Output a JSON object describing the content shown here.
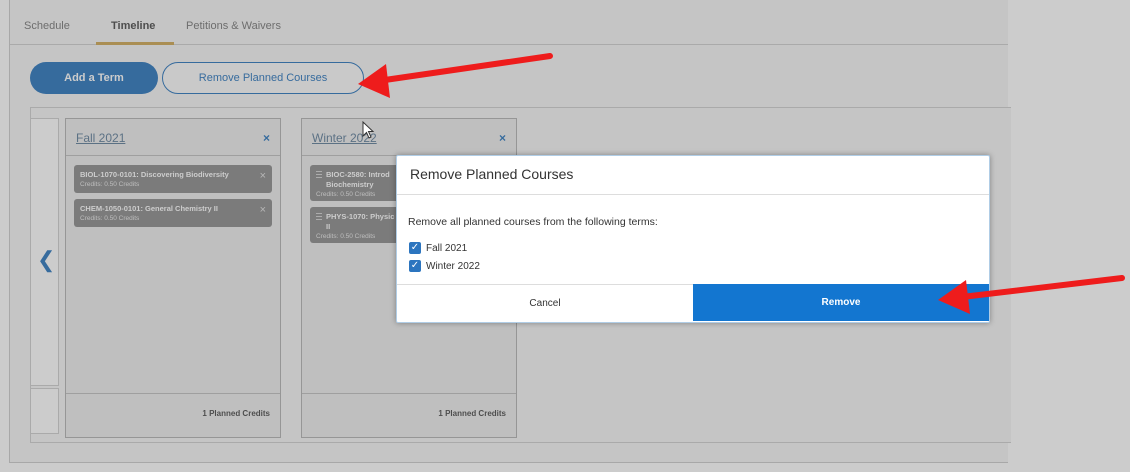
{
  "tabs": [
    {
      "label": "Schedule"
    },
    {
      "label": "Timeline"
    },
    {
      "label": "Petitions & Waivers"
    }
  ],
  "actions": {
    "add_term": "Add a Term",
    "remove_planned": "Remove Planned Courses"
  },
  "terms": [
    {
      "title": "Fall 2021",
      "close": "×",
      "courses": [
        {
          "name": "BIOL-1070-0101: Discovering Biodiversity",
          "credits": "Credits: 0.50 Credits"
        },
        {
          "name": "CHEM-1050-0101: General Chemistry II",
          "credits": "Credits: 0.50 Credits"
        }
      ],
      "footer": "1 Planned Credits"
    },
    {
      "title": "Winter 2022",
      "close": "×",
      "courses": [
        {
          "name_line1": "BIOC-2580: Introd",
          "name_line2": "Biochemistry",
          "credits": "Credits: 0.50 Credits"
        },
        {
          "name_line1": "PHYS-1070: Physic",
          "name_line2": "II",
          "credits": "Credits: 0.50 Credits"
        }
      ],
      "footer": "1 Planned Credits"
    }
  ],
  "dialog": {
    "title": "Remove Planned Courses",
    "prompt": "Remove all planned courses from the following terms:",
    "options": [
      {
        "label": "Fall 2021",
        "checked": true
      },
      {
        "label": "Winter 2022",
        "checked": true
      }
    ],
    "cancel": "Cancel",
    "remove": "Remove"
  },
  "icons": {
    "prev": "chevron-left-icon",
    "check": "checkmark-icon",
    "close": "close-icon"
  },
  "colors": {
    "primary": "#0e63b4",
    "remove_button": "#1376d0",
    "tab_accent": "#c89b3c",
    "annotation_arrow": "#ee1c1c"
  }
}
